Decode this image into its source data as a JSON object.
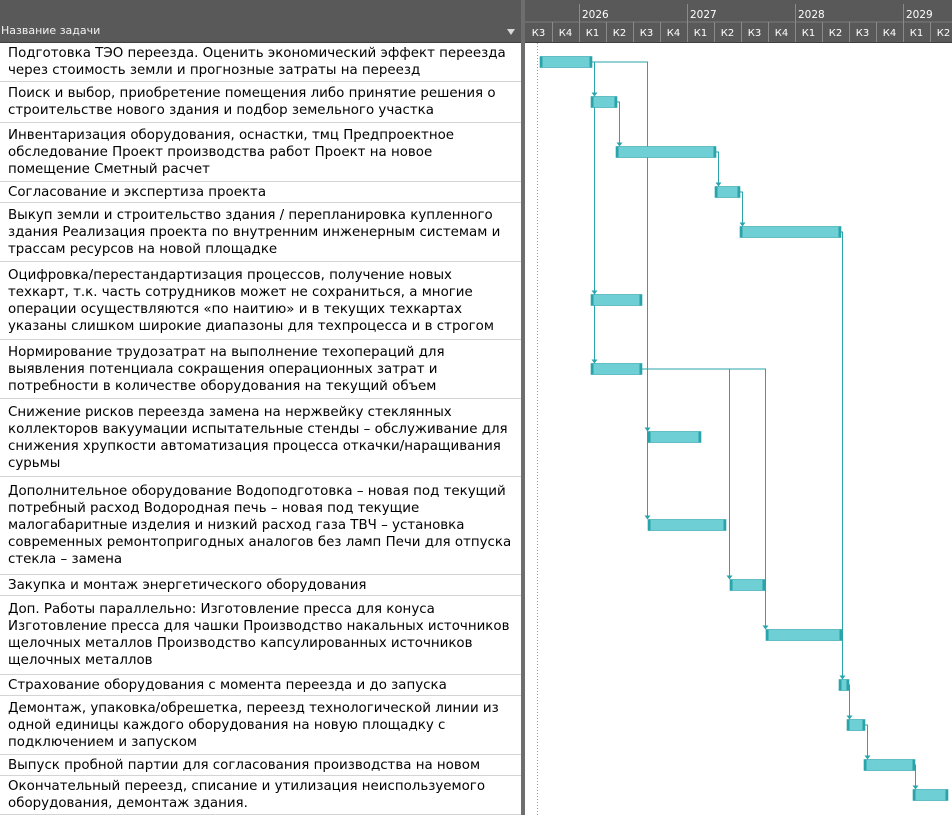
{
  "header": {
    "task_name_label": "Название задачи"
  },
  "timeline": {
    "years": [
      "2026",
      "2027",
      "2028",
      "2029"
    ],
    "quarters": [
      "К3",
      "К4",
      "К1",
      "К2",
      "К3",
      "К4",
      "К1",
      "К2",
      "К3",
      "К4",
      "К1",
      "К2",
      "К3",
      "К4",
      "К1",
      "К2"
    ]
  },
  "tasks": [
    {
      "name": "Подготовка ТЭО переезда. Оценить экономический эффект переезда через стоимость земли и прогнозные затраты на переезд"
    },
    {
      "name": "Поиск и выбор, приобретение помещения либо принятие решения о строительстве нового здания и подбор земельного участка"
    },
    {
      "name": "Инвентаризация оборудования, оснастки, тмц Предпроектное обследование Проект производства работ Проект на новое помещение Сметный расчет"
    },
    {
      "name": "Согласование и экспертиза проекта"
    },
    {
      "name": "Выкуп земли и строительство здания / перепланировка купленного здания Реализация проекта по внутренним инженерным системам и трассам ресурсов на новой площадке"
    },
    {
      "name": "Оцифровка/перестандартизация процессов, получение новых техкарт, т.к. часть сотрудников может не сохраниться, а многие операции осуществляются «по наитию» и в текущих техкартах указаны слишком широкие диапазоны для техпроцесса и в строгом соответствии с н"
    },
    {
      "name": "Нормирование трудозатрат на выполнение техопераций для выявления потенциала сокращения операционных затрат и потребности в количестве оборудования на текущий объем производства"
    },
    {
      "name": "Снижение рисков переезда замена на нержвейку стеклянных коллекторов вакуумации испытательные стенды – обслуживание для снижения хрупкости автоматизация процесса откачки/наращивания сурьмы"
    },
    {
      "name": "Дополнительное оборудование Водоподготовка – новая под текущий потребный расход Водородная печь – новая под текущие малогабаритные изделия и низкий расход газа ТВЧ – установка современных ремонтопригодных аналогов без ламп Печи для отпуска стекла – замена"
    },
    {
      "name": "Закупка и монтаж энергетического оборудования"
    },
    {
      "name": "Доп. Работы параллельно: Изготовление пресса для конуса Изготовление пресса для чашки Производство накальных источников щелочных металлов Производство капсулированных источников щелочных металлов"
    },
    {
      "name": "Страхование оборудования с момента переезда и до запуска"
    },
    {
      "name": "Демонтаж, упаковка/обрешетка, переезд технологической линии из одной единицы каждого оборудования на новую площадку с подключением и запуском"
    },
    {
      "name": "Выпуск пробной партии для согласования производства на новом месте"
    },
    {
      "name": "Окончательный переезд, списание и утилизация неиспользуемого оборудования, демонтаж здания."
    }
  ],
  "colors": {
    "bar": "#6ecfd4",
    "bar_edge": "#2aa3aa",
    "link": "#2aa3aa",
    "header_bg": "#595959"
  }
}
